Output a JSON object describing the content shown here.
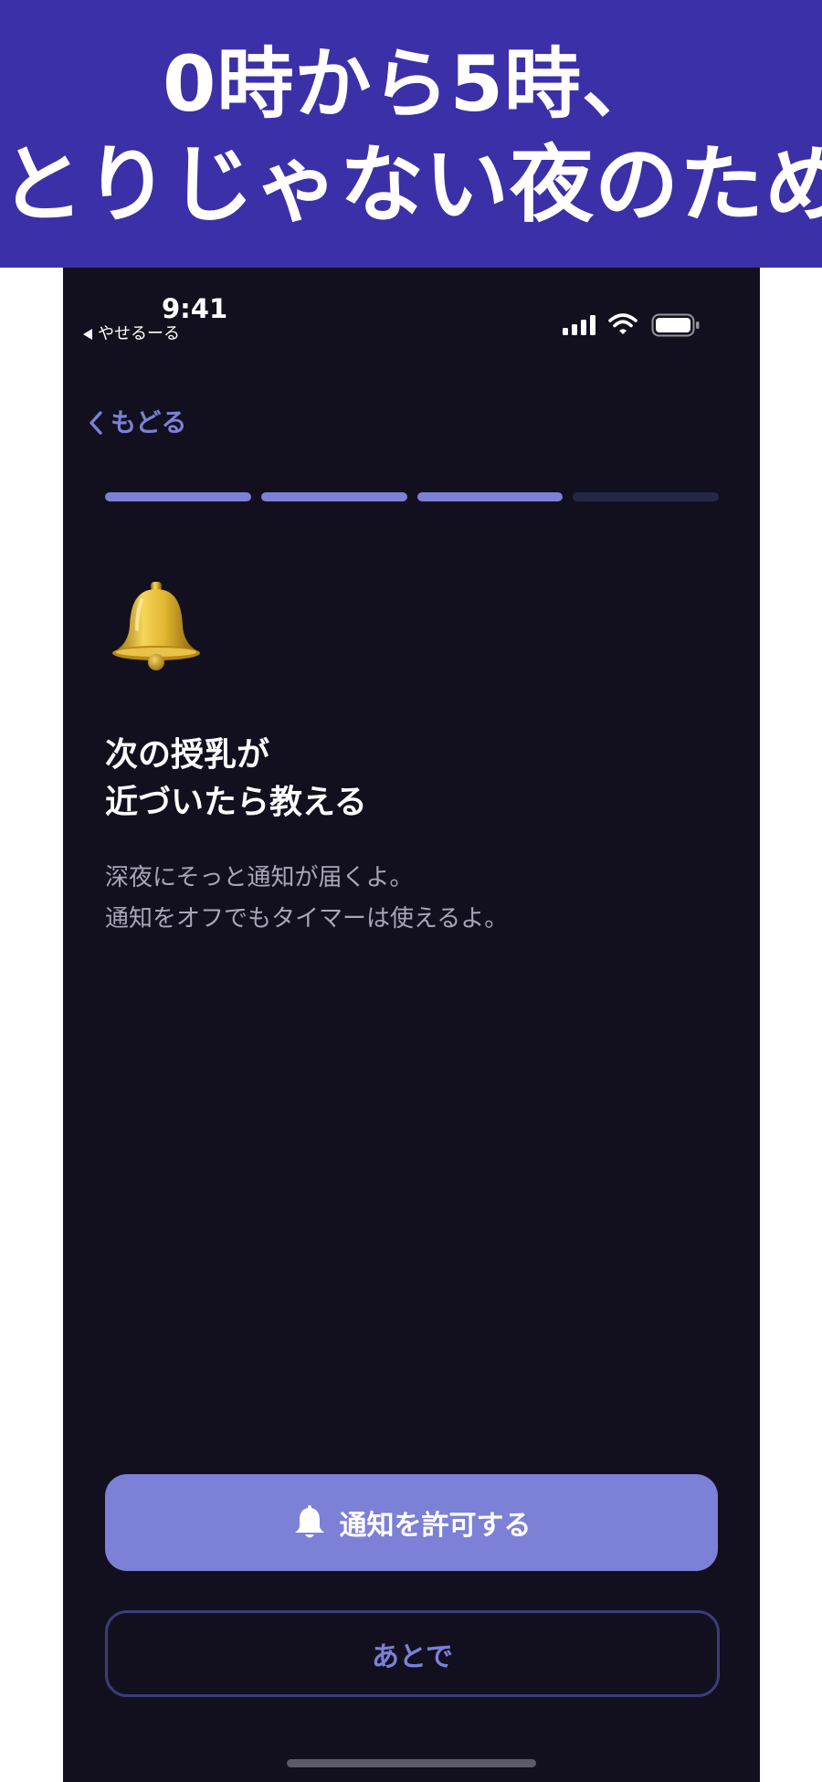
{
  "banner": {
    "line1": "0時から5時、",
    "line2": "とりじゃない夜のために"
  },
  "status_bar": {
    "time": "9:41",
    "back_app": "やせるーる",
    "icons": [
      "signal-icon",
      "wifi-icon",
      "battery-icon"
    ]
  },
  "nav": {
    "back_label": "もどる"
  },
  "progress": {
    "total_steps": 4,
    "completed_steps": 3
  },
  "content": {
    "icon": "bell-icon",
    "heading_line1": "次の授乳が",
    "heading_line2": "近づいたら教える",
    "body_line1": "深夜にそっと通知が届くよ。",
    "body_line2": "通知をオフでもタイマーは使えるよ。"
  },
  "buttons": {
    "allow_label": "通知を許可する",
    "later_label": "あとで"
  },
  "colors": {
    "banner_bg": "#3b30a8",
    "screen_bg": "#12101f",
    "accent": "#7c80d6",
    "text_primary": "#ffffff",
    "text_secondary": "#a8a6b8",
    "outline": "#3e3b78"
  }
}
